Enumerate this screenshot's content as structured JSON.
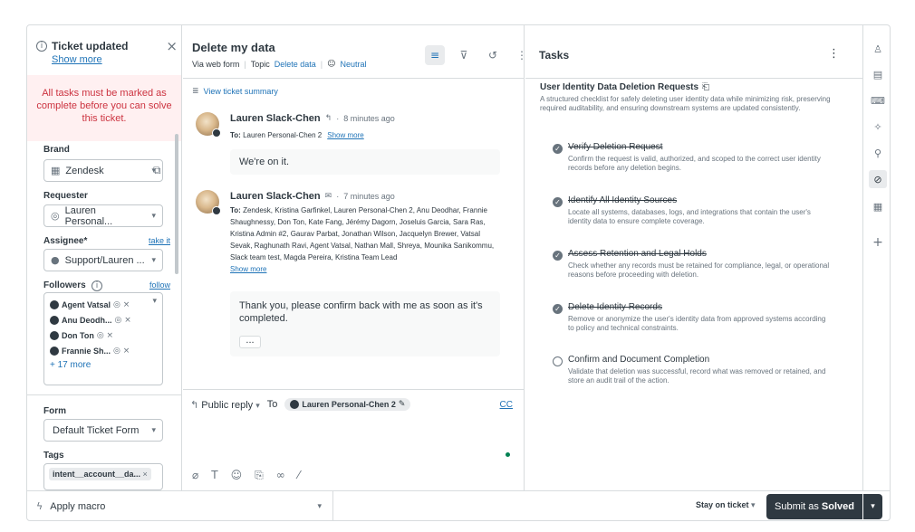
{
  "notification": {
    "title": "Ticket updated",
    "show_more": "Show more",
    "close_icon": "×"
  },
  "alert": {
    "text": "All tasks must be marked as complete before you can solve this ticket."
  },
  "brand": {
    "label": "Brand",
    "value": "Zendesk"
  },
  "requester": {
    "label": "Requester",
    "value": "Lauren Personal..."
  },
  "assignee": {
    "label": "Assignee*",
    "take_it": "take it",
    "value": "Support/Lauren ..."
  },
  "followers": {
    "label": "Followers",
    "follow": "follow",
    "items": [
      "Agent Vatsal",
      "Anu Deodh...",
      "Don Ton",
      "Frannie Sh..."
    ],
    "more": "+ 17 more"
  },
  "form": {
    "label": "Form",
    "value": "Default Ticket Form"
  },
  "tags": {
    "label": "Tags",
    "items": [
      "intent__account__da..."
    ]
  },
  "ticket": {
    "subject": "Delete my data",
    "via": "Via web form",
    "topic_label": "Topic",
    "topic_value": "Delete data",
    "sentiment": "Neutral",
    "view_summary": "View ticket summary"
  },
  "messages": [
    {
      "author": "Lauren Slack-Chen",
      "time": "8 minutes ago",
      "to_label": "To:",
      "to": "Lauren Personal-Chen 2",
      "show_more": "Show more",
      "body": "We're on it."
    },
    {
      "author": "Lauren Slack-Chen",
      "time": "7 minutes ago",
      "to_label": "To:",
      "to": "Zendesk, Kristina Garfinkel, Lauren Personal-Chen 2, Anu Deodhar, Frannie Shaughnessy, Don Ton, Kate Fang, Jérémy Dagorn, Joseluis Garcia, Sara Ras, Kristina Admin #2, Gaurav Parbat, Jonathan Wilson, Jacquelyn Brewer, Vatsal Sevak, Raghunath Ravi, Agent Vatsal, Nathan Mall, Shreya, Mounika Sanikommu, Slack team test, Magda Pereira, Kristina Team Lead",
      "show_more": "Show more",
      "body": "Thank you, please confirm back with me as soon as it's completed.",
      "expand": "..."
    }
  ],
  "reply": {
    "mode": "Public reply",
    "to_label": "To",
    "recipient": "Lauren Personal-Chen 2",
    "cc": "CC"
  },
  "tasks": {
    "title": "Tasks",
    "list_title": "User Identity Data Deletion Requests",
    "list_desc": "A structured checklist for safely deleting user identity data while minimizing risk, preserving required auditability, and ensuring downstream systems are updated consistently.",
    "items": [
      {
        "title": "Verify Deletion Request",
        "desc": "Confirm the request is valid, authorized, and scoped to the correct user identity records before any deletion begins.",
        "done": true
      },
      {
        "title": "Identify All Identity Sources",
        "desc": "Locate all systems, databases, logs, and integrations that contain the user's identity data to ensure complete coverage.",
        "done": true
      },
      {
        "title": "Assess Retention and Legal Holds",
        "desc": "Check whether any records must be retained for compliance, legal, or operational reasons before proceeding with deletion.",
        "done": true
      },
      {
        "title": "Delete Identity Records",
        "desc": "Remove or anonymize the user's identity data from approved systems according to policy and technical constraints.",
        "done": true
      },
      {
        "title": "Confirm and Document Completion",
        "desc": "Validate that deletion was successful, record what was removed or retained, and store an audit trail of the action.",
        "done": false
      }
    ]
  },
  "bottom": {
    "macro": "Apply macro",
    "stay": "Stay on ticket",
    "submit_prefix": "Submit as",
    "submit_status": "Solved"
  },
  "colors": {
    "primary_text": "#2f3941",
    "link": "#1f73b7",
    "alert_bg": "#fff0f1",
    "alert_text": "#cc3340",
    "submit_bg": "#2f3941"
  }
}
